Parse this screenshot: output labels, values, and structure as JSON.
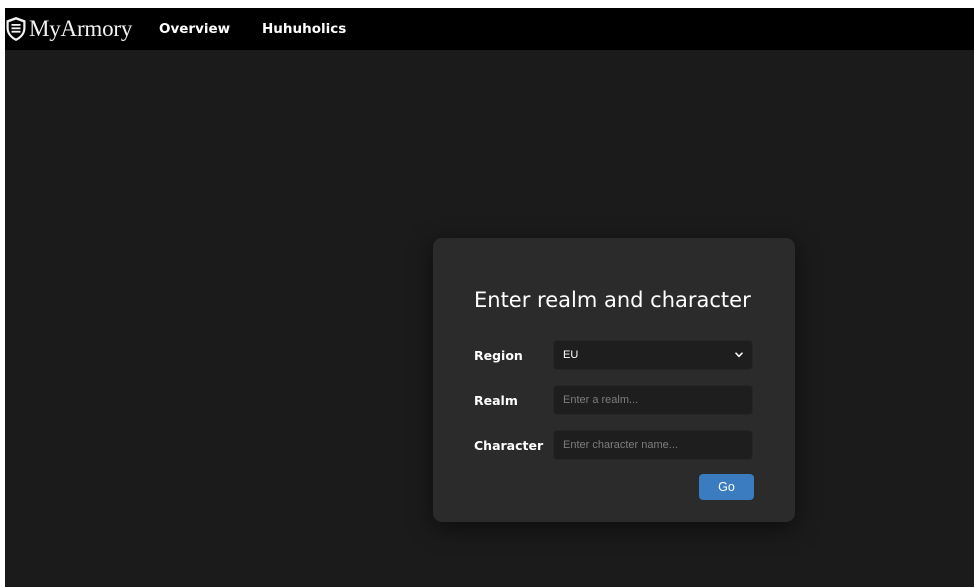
{
  "navbar": {
    "brand": {
      "icon": "shield-icon",
      "label": "MyArmory"
    },
    "links": [
      {
        "label": "Overview"
      },
      {
        "label": "Huhuholics"
      }
    ]
  },
  "form": {
    "title": "Enter realm and character",
    "region": {
      "label": "Region",
      "selected": "EU",
      "icon": "chevron-down-icon"
    },
    "realm": {
      "label": "Realm",
      "value": "",
      "placeholder": "Enter a realm..."
    },
    "character": {
      "label": "Character",
      "value": "",
      "placeholder": "Enter character name..."
    },
    "submit_label": "Go"
  },
  "colors": {
    "navbar_bg": "#000000",
    "page_bg": "#1b1b1b",
    "card_bg": "#2b2b2b",
    "input_bg": "#1e1e1e",
    "button_bg": "#3b7bbf",
    "text": "#ffffff",
    "placeholder": "#7d7d7d"
  }
}
